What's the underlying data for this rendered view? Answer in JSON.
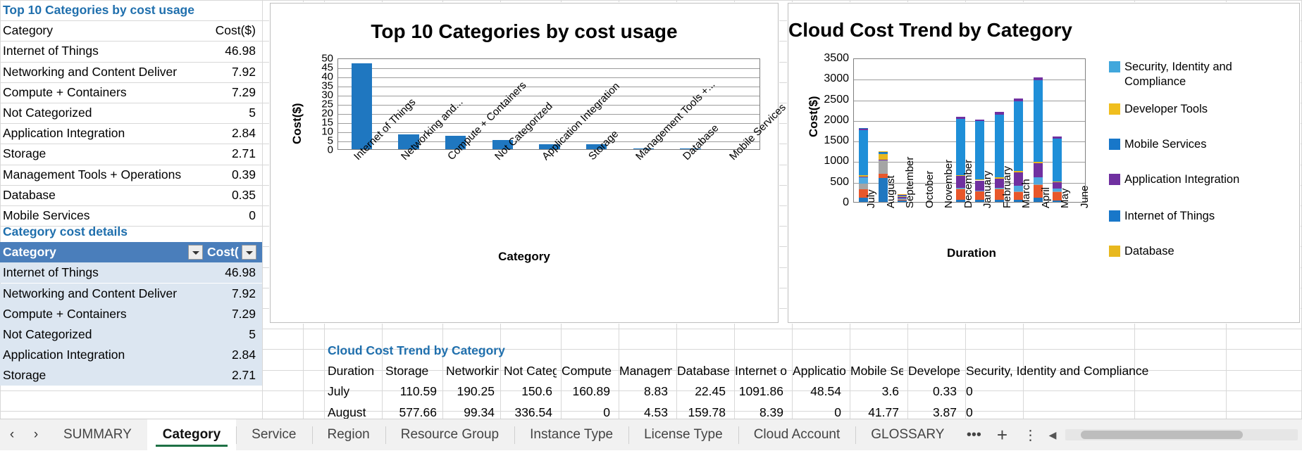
{
  "tableA": {
    "title": "Top 10 Categories by cost usage",
    "columns": [
      "Category",
      "Cost($)"
    ],
    "rows": [
      {
        "category": "Internet of Things",
        "cost": "46.98"
      },
      {
        "category": "Networking and Content Deliver",
        "cost": "7.92"
      },
      {
        "category": "Compute + Containers",
        "cost": "7.29"
      },
      {
        "category": "Not Categorized",
        "cost": "5"
      },
      {
        "category": "Application Integration",
        "cost": "2.84"
      },
      {
        "category": "Storage",
        "cost": "2.71"
      },
      {
        "category": "Management Tools + Operations",
        "cost": "0.39"
      },
      {
        "category": "Database",
        "cost": "0.35"
      },
      {
        "category": "Mobile Services",
        "cost": "0"
      }
    ]
  },
  "tableB": {
    "title": "Category cost details",
    "columns": [
      "Category",
      "Cost("
    ],
    "rows": [
      {
        "category": "Internet of Things",
        "cost": "46.98"
      },
      {
        "category": "Networking and Content Deliver",
        "cost": "7.92"
      },
      {
        "category": "Compute + Containers",
        "cost": "7.29"
      },
      {
        "category": "Not Categorized",
        "cost": "5"
      },
      {
        "category": "Application Integration",
        "cost": "2.84"
      },
      {
        "category": "Storage",
        "cost": "2.71"
      }
    ]
  },
  "tableC": {
    "title": "Cloud Cost Trend by Category",
    "columns": [
      "Duration",
      "Storage",
      "Networkin",
      "Not Categ",
      "Compute ",
      "Managem",
      "Database",
      "Internet o",
      "Applicatio",
      "Mobile Se",
      "Developer",
      "Security, Identity and Compliance"
    ],
    "rows": [
      [
        "July",
        "110.59",
        "190.25",
        "150.6",
        "160.89",
        "8.83",
        "22.45",
        "1091.86",
        "48.54",
        "3.6",
        "0.33",
        "0"
      ],
      [
        "August",
        "577.66",
        "99.34",
        "336.54",
        "0",
        "4.53",
        "159.78",
        "8.39",
        "0",
        "41.77",
        "3.87",
        "0"
      ]
    ]
  },
  "chart_data": [
    {
      "type": "bar",
      "title": "Top 10 Categories by cost usage",
      "xlabel": "Category",
      "ylabel": "Cost($)",
      "ylim": [
        0,
        50
      ],
      "yticks": [
        0,
        5,
        10,
        15,
        20,
        25,
        30,
        35,
        40,
        45,
        50
      ],
      "grid": true,
      "legend": "none",
      "bar_color": "#1F77C0",
      "categories": [
        "Internet of Things",
        "Networking and...",
        "Compute + Containers",
        "Not Categorized",
        "Application Integration",
        "Storage",
        "Management Tools +...",
        "Database",
        "Mobile Services"
      ],
      "values": [
        46.98,
        7.92,
        7.29,
        5,
        2.84,
        2.71,
        0.39,
        0.35,
        0
      ]
    },
    {
      "type": "bar",
      "stacked": true,
      "title": "Cloud Cost Trend by Category",
      "xlabel": "Duration",
      "ylabel": "Cost($)",
      "ylim": [
        0,
        3500
      ],
      "yticks": [
        0,
        500,
        1000,
        1500,
        2000,
        2500,
        3000,
        3500
      ],
      "grid": true,
      "legend": "right",
      "categories": [
        "July",
        "August",
        "September",
        "October",
        "November",
        "December",
        "January",
        "February",
        "March",
        "April",
        "May",
        "June"
      ],
      "series": [
        {
          "name": "Storage",
          "color": "#1F77C0",
          "values": [
            110.59,
            577.66,
            40,
            0,
            0,
            60,
            60,
            60,
            60,
            100,
            35,
            0
          ]
        },
        {
          "name": "Networking and Content Delivery",
          "color": "#E8572B",
          "values": [
            190.25,
            99.34,
            25,
            0,
            0,
            240,
            190,
            250,
            180,
            310,
            200,
            0
          ]
        },
        {
          "name": "Not Categorized",
          "color": "#A5A5A5",
          "values": [
            150.6,
            336.54,
            10,
            0,
            0,
            20,
            15,
            15,
            20,
            20,
            15,
            0
          ]
        },
        {
          "name": "Compute + Containers",
          "color": "#4FA8E0",
          "values": [
            160.89,
            0,
            8,
            0,
            0,
            18,
            16,
            16,
            135,
            170,
            70,
            0
          ]
        },
        {
          "name": "Management Tools + Operations",
          "color": "#7030A0",
          "values": [
            8.83,
            4.53,
            40,
            0,
            0,
            290,
            240,
            230,
            330,
            340,
            160,
            0
          ]
        },
        {
          "name": "Database",
          "color": "#E8B81E",
          "values": [
            22.45,
            159.78,
            6,
            0,
            0,
            22,
            20,
            22,
            22,
            26,
            18,
            0
          ]
        },
        {
          "name": "Internet of Things",
          "color": "#1F8FD8",
          "values": [
            1091.86,
            8.39,
            30,
            0,
            0,
            1370,
            1420,
            1520,
            1690,
            1980,
            1040,
            0
          ]
        },
        {
          "name": "Application Integration",
          "color": "#7030A0",
          "values": [
            48.54,
            0,
            18,
            0,
            0,
            40,
            40,
            65,
            70,
            75,
            45,
            0
          ]
        },
        {
          "name": "Mobile Services",
          "color": "#1F77C0",
          "values": [
            3.6,
            41.77,
            5,
            0,
            0,
            0,
            0,
            0,
            0,
            0,
            0,
            0
          ]
        },
        {
          "name": "Developer Tools",
          "color": "#F0BE1E",
          "values": [
            0.33,
            3.87,
            4,
            0,
            0,
            0,
            0,
            0,
            0,
            0,
            0,
            0
          ]
        },
        {
          "name": "Security, Identity and Compliance",
          "color": "#4FA8E0",
          "values": [
            0,
            0,
            0,
            0,
            0,
            0,
            0,
            0,
            0,
            0,
            0,
            0
          ]
        }
      ],
      "legend_entries": [
        {
          "label": "Security, Identity and Compliance",
          "color": "#41A7DC"
        },
        {
          "label": "Developer Tools",
          "color": "#F0BE1E"
        },
        {
          "label": "Mobile Services",
          "color": "#1877C9"
        },
        {
          "label": "Application Integration",
          "color": "#7030A0"
        },
        {
          "label": "Internet of Things",
          "color": "#1877C9"
        },
        {
          "label": "Database",
          "color": "#E8B81E"
        }
      ]
    }
  ],
  "tabbar": {
    "prev_label": "‹",
    "next_label": "›",
    "tabs": [
      {
        "label": "SUMMARY",
        "active": false
      },
      {
        "label": "Category",
        "active": true
      },
      {
        "label": "Service",
        "active": false
      },
      {
        "label": "Region",
        "active": false
      },
      {
        "label": "Resource Group",
        "active": false
      },
      {
        "label": "Instance Type",
        "active": false
      },
      {
        "label": "License Type",
        "active": false
      },
      {
        "label": "Cloud Account",
        "active": false
      },
      {
        "label": "GLOSSARY",
        "active": false
      }
    ],
    "overflow_label": "•••",
    "add_sheet_label": "+",
    "more_label": "⋮",
    "scroll_left_label": "◀"
  }
}
